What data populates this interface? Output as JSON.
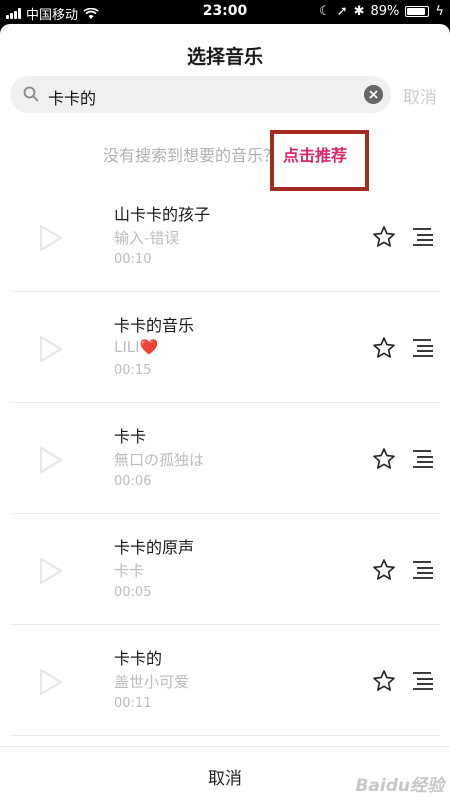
{
  "status_bar": {
    "carrier": "中国移动",
    "time": "23:00",
    "battery_percent_label": "89%",
    "battery_level": 0.89
  },
  "sheet": {
    "title": "选择音乐"
  },
  "search": {
    "query": "卡卡的",
    "cancel_label": "取消"
  },
  "hint": {
    "text": "没有搜索到想要的音乐？",
    "link_label": "点击推荐"
  },
  "songs": [
    {
      "title": "山卡卡的孩子",
      "artist": "输入-错误",
      "duration": "00:10"
    },
    {
      "title": "卡卡的音乐",
      "artist": "LILI❤️",
      "duration": "00:15"
    },
    {
      "title": "卡卡",
      "artist": "無口の孤独は",
      "duration": "00:06"
    },
    {
      "title": "卡卡的原声",
      "artist": "卡卡",
      "duration": "00:05"
    },
    {
      "title": "卡卡的",
      "artist": "盖世小可爱",
      "duration": "00:11"
    }
  ],
  "footer": {
    "cancel_label": "取消",
    "watermark": "Baidu经验"
  },
  "colors": {
    "accent": "#d6286b",
    "highlight_border": "#a52a22"
  }
}
